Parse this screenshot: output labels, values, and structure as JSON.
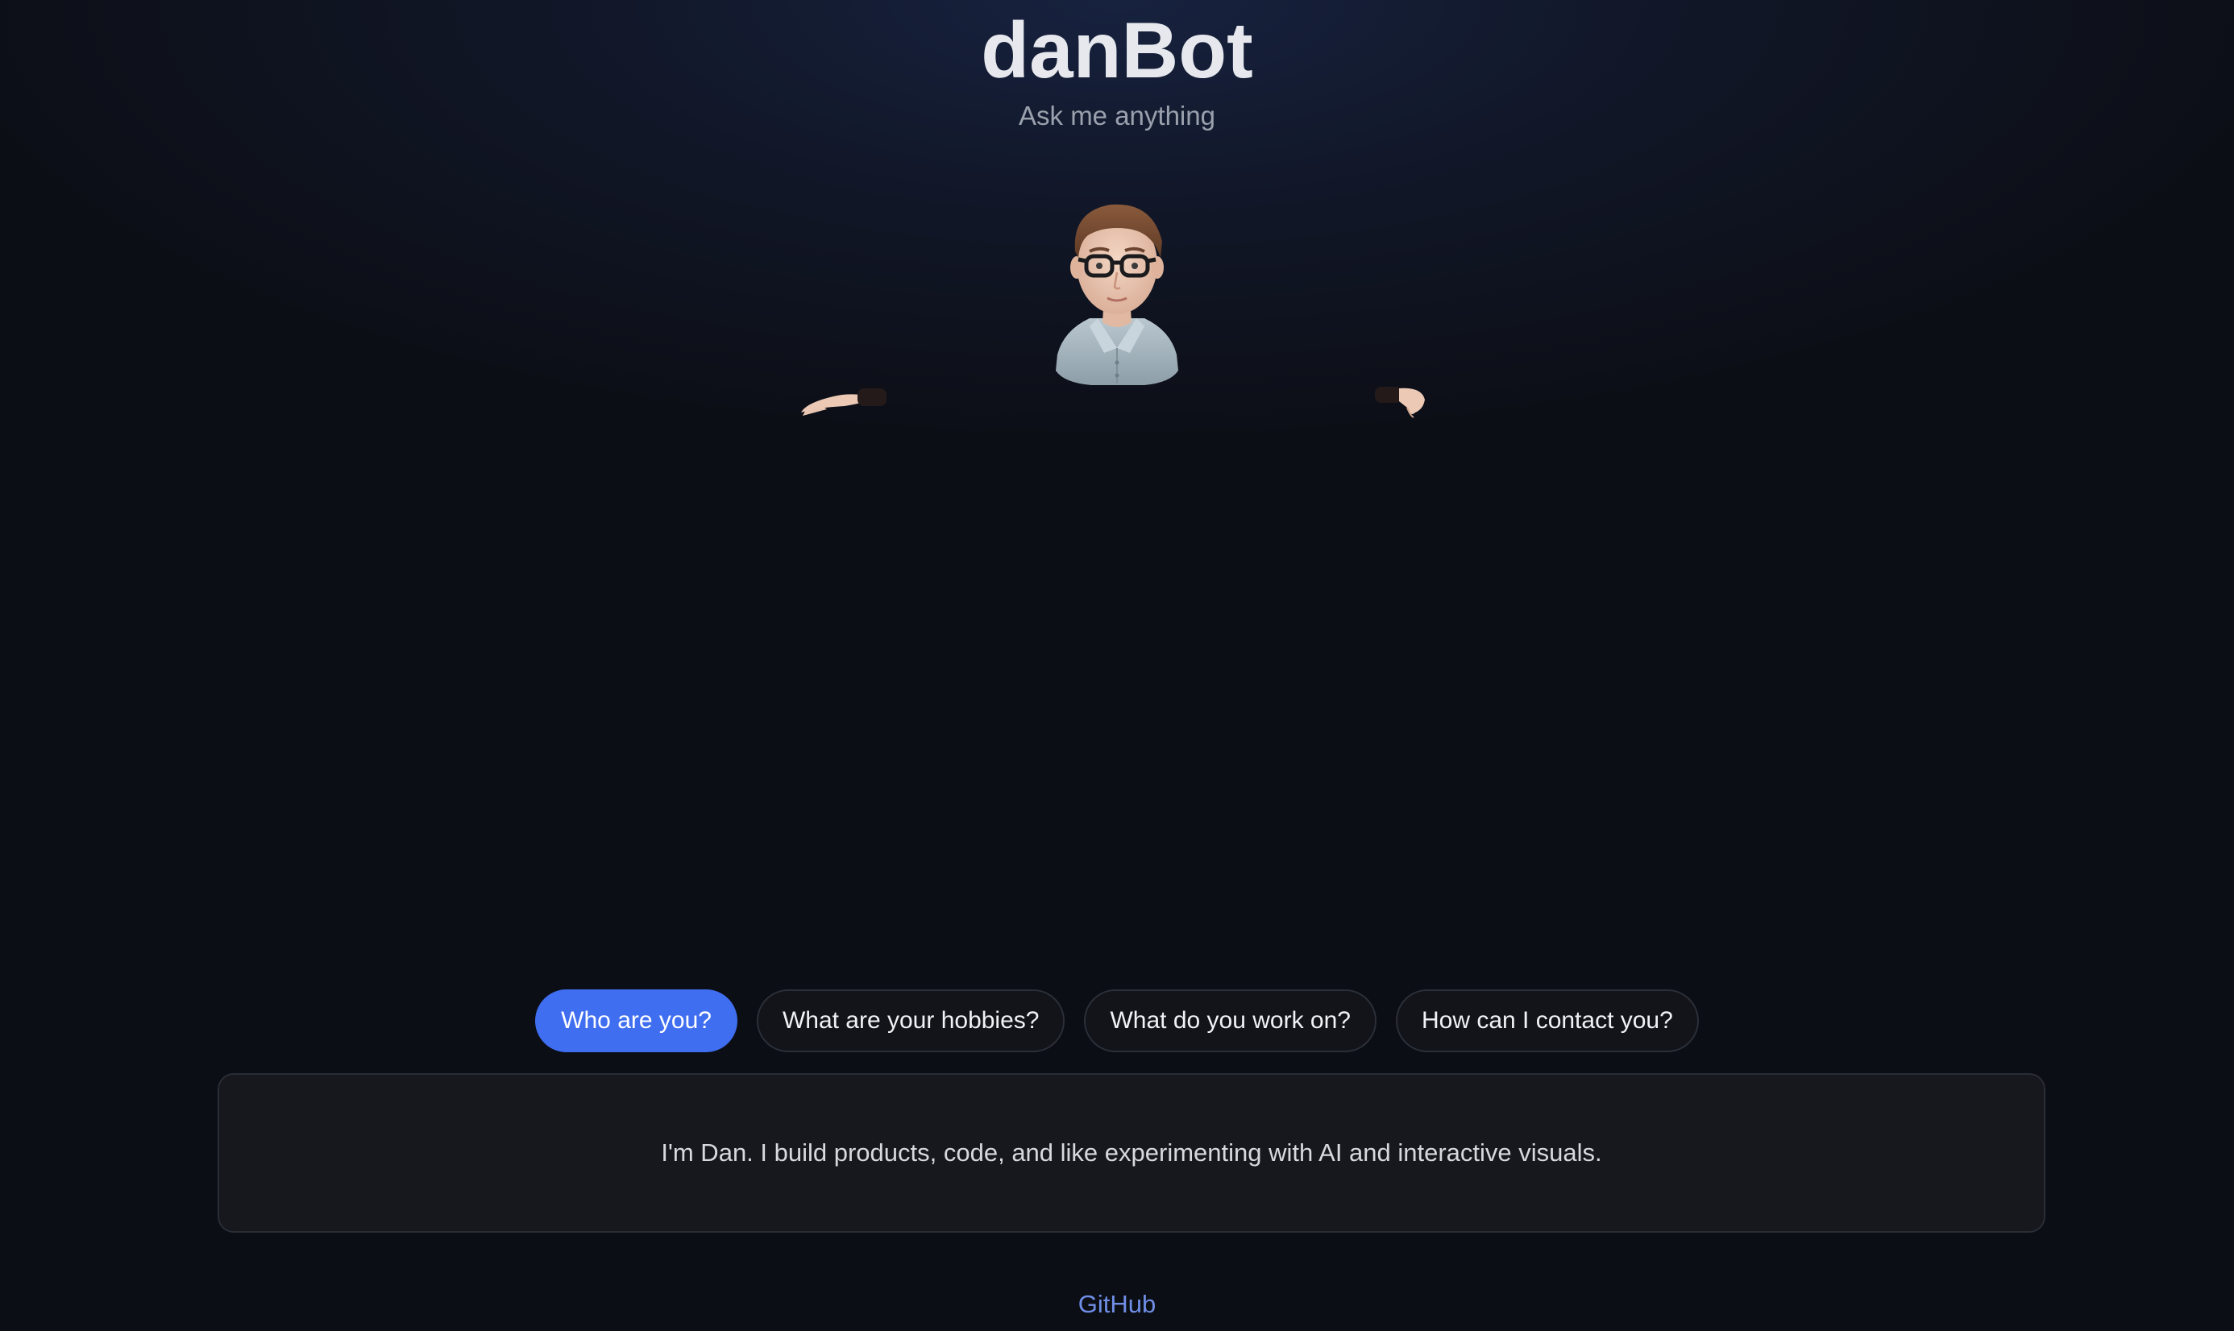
{
  "header": {
    "title": "danBot",
    "subtitle": "Ask me anything"
  },
  "avatar": {
    "icon": "3d-avatar-man-with-glasses"
  },
  "questions": [
    {
      "label": "Who are you?",
      "active": true
    },
    {
      "label": "What are your hobbies?",
      "active": false
    },
    {
      "label": "What do you work on?",
      "active": false
    },
    {
      "label": "How can I contact you?",
      "active": false
    }
  ],
  "answer": {
    "text": "I'm Dan. I build products, code, and like experimenting with AI and interactive visuals."
  },
  "footer": {
    "link_label": "GitHub"
  },
  "colors": {
    "accent": "#3f6ef0",
    "link": "#6f8ee6",
    "background": "#0c0e15"
  }
}
